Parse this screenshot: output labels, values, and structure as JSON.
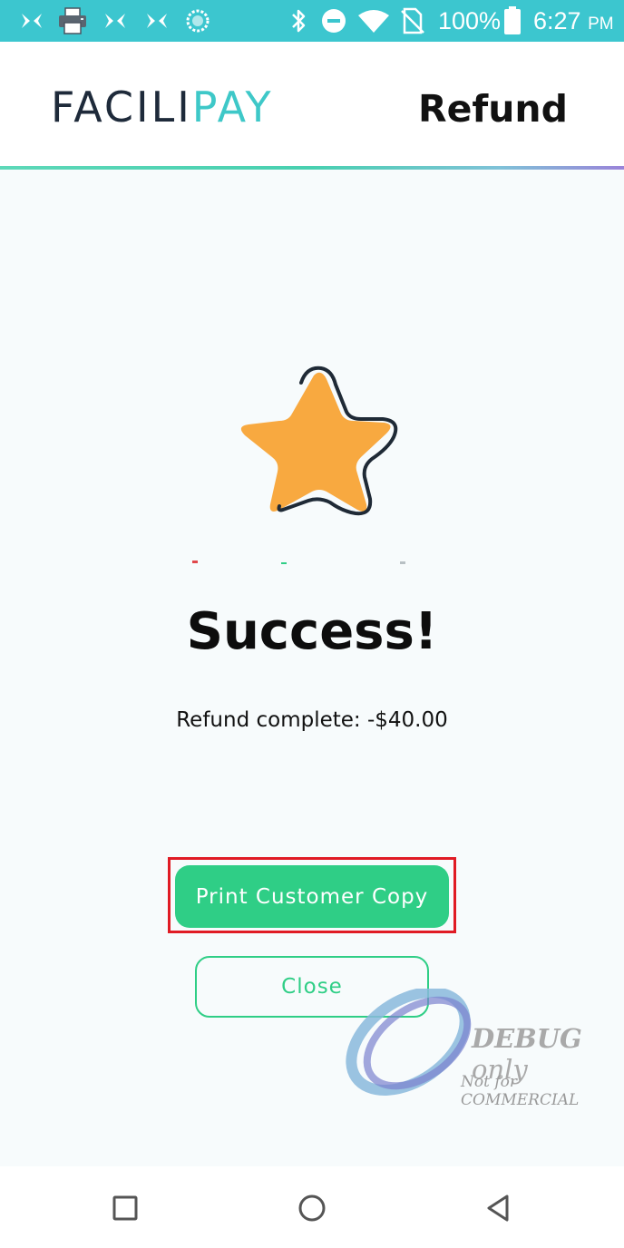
{
  "status_bar": {
    "icons": [
      "app-notification-icon",
      "printer-icon",
      "app-notification-icon",
      "app-notification-icon",
      "sync-icon",
      "bluetooth-icon",
      "do-not-disturb-icon",
      "wifi-icon",
      "no-sim-icon",
      "battery-icon"
    ],
    "battery": "100%",
    "time": "6:27",
    "ampm": "PM"
  },
  "header": {
    "logo_part1": "FACILI",
    "logo_part2": "PAY",
    "title": "Refund"
  },
  "main": {
    "icon": "star-icon",
    "title": "Success!",
    "message": "Refund complete: -$40.00",
    "print_button": "Print Customer Copy",
    "close_button": "Close"
  },
  "watermark": {
    "line1_bold": "DEBUG",
    "line1_light": " only",
    "line2": "Not for COMMERCIAL"
  },
  "nav_bar": {
    "icons": [
      "recent-apps-icon",
      "home-icon",
      "back-icon"
    ]
  },
  "colors": {
    "status_bar": "#3cc6cf",
    "accent_green": "#2fce86",
    "logo_dark": "#1e2a3a",
    "logo_teal": "#3ec8c8",
    "star_fill": "#f8a940",
    "highlight_red": "#e01b24"
  }
}
